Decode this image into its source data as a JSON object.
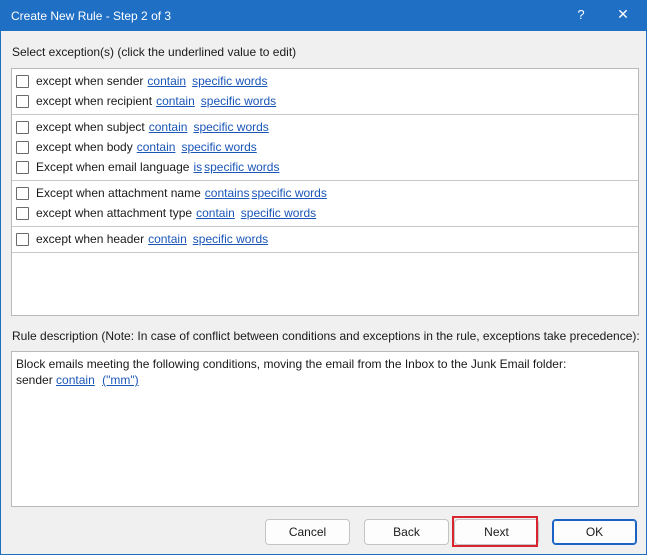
{
  "window": {
    "title": "Create New Rule - Step 2 of 3",
    "help_glyph": "?",
    "close_glyph": "✕"
  },
  "exceptions": {
    "header": "Select exception(s) (click the underlined value to edit)",
    "groups": [
      [
        {
          "text": "except when sender",
          "link1": "contain",
          "link2": "specific words",
          "checked": false
        },
        {
          "text": "except when recipient",
          "link1": "contain",
          "link2": "specific words",
          "checked": false
        }
      ],
      [
        {
          "text": "except when subject",
          "link1": "contain",
          "link2": "specific words",
          "checked": false
        },
        {
          "text": "except when body",
          "link1": "contain",
          "link2": "specific words",
          "checked": false
        },
        {
          "text": "Except when email language",
          "link1": "is",
          "link2": "specific words",
          "checked": false
        }
      ],
      [
        {
          "text": "Except when attachment name",
          "link1": "contains",
          "link2": "specific words",
          "checked": false
        },
        {
          "text": "except when attachment type",
          "link1": "contain",
          "link2": "specific words",
          "checked": false
        }
      ],
      [
        {
          "text": "except when header",
          "link1": "contain",
          "link2": "specific words",
          "checked": false
        }
      ]
    ]
  },
  "description": {
    "header": "Rule description (Note: In case of conflict between conditions and exceptions in the rule, exceptions take precedence):",
    "line1": "Block emails meeting the following conditions, moving the email from the Inbox to the Junk Email folder:",
    "line2_prefix": "sender",
    "line2_link1": "contain",
    "line2_link2": "(\"mm\")"
  },
  "buttons": {
    "cancel": "Cancel",
    "back": "Back",
    "next": "Next",
    "ok": "OK"
  },
  "colors": {
    "titlebar": "#1f6fc5",
    "link": "#1a56b8",
    "highlight": "#d9262e"
  }
}
